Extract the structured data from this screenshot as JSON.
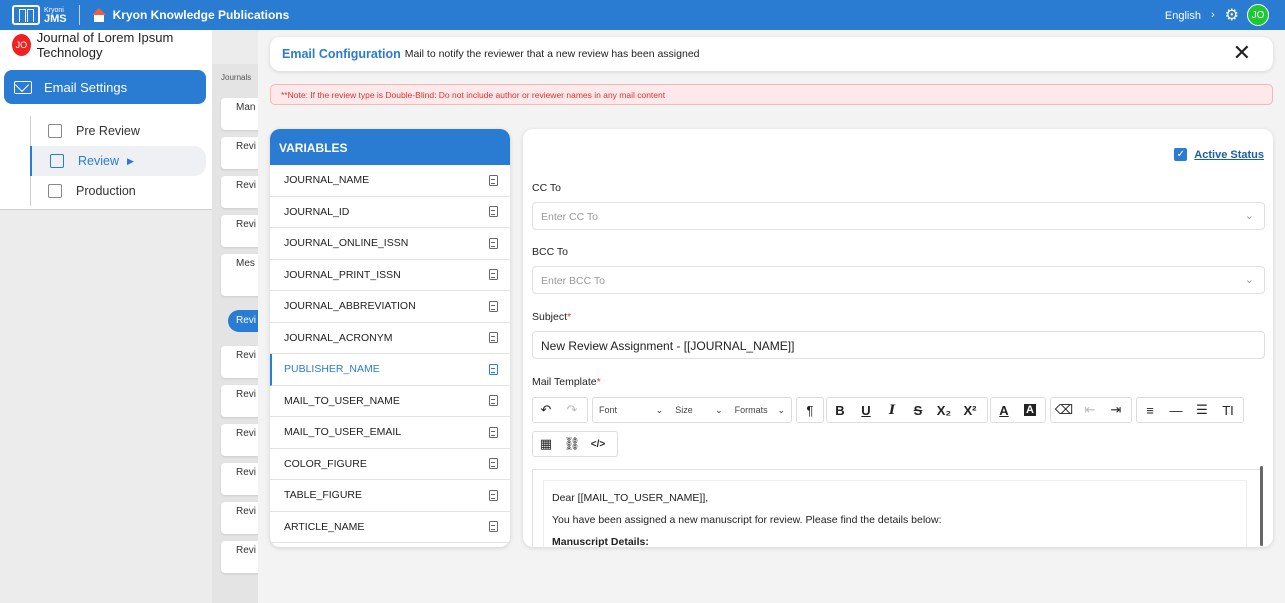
{
  "topbar": {
    "brand_small": "Kryoni",
    "brand_big": "JMS",
    "app_title": "Kryon Knowledge Publications",
    "language": "English",
    "avatar_initials": "JO"
  },
  "sidebar": {
    "journal_initials": "JO",
    "journal_name": "Journal of Lorem Ipsum Technology",
    "main_item": "Email Settings",
    "sub_items": [
      {
        "label": "Pre Review"
      },
      {
        "label": "Review"
      },
      {
        "label": "Production"
      }
    ]
  },
  "midcol": {
    "crumb": "Journals",
    "cards": [
      "Man",
      "Revi",
      "Revi",
      "Revi",
      "Mes disc",
      "Revi",
      "Revi",
      "Revi",
      "Revi",
      "Revi",
      "Revi"
    ],
    "pill": "Revi"
  },
  "header": {
    "title": "Email Configuration",
    "subtitle": "Mail to notify the reviewer that a new review has been assigned",
    "close": "✕"
  },
  "note": "**Note: If the review type is Double-Blind: Do not include author or reviewer names in any mail content",
  "variables": {
    "heading": "VARIABLES",
    "items": [
      "JOURNAL_NAME",
      "JOURNAL_ID",
      "JOURNAL_ONLINE_ISSN",
      "JOURNAL_PRINT_ISSN",
      "JOURNAL_ABBREVIATION",
      "JOURNAL_ACRONYM",
      "PUBLISHER_NAME",
      "MAIL_TO_USER_NAME",
      "MAIL_TO_USER_EMAIL",
      "COLOR_FIGURE",
      "TABLE_FIGURE",
      "ARTICLE_NAME"
    ],
    "active_index": 6
  },
  "form": {
    "active_status_label": "Active Status",
    "cc_label": "CC To",
    "cc_placeholder": "Enter CC To",
    "bcc_label": "BCC To",
    "bcc_placeholder": "Enter BCC To",
    "subject_label": "Subject",
    "subject_value": "New Review Assignment - [[JOURNAL_NAME]]",
    "template_label": "Mail Template",
    "required_mark": "*"
  },
  "toolbar": {
    "font_label": "Font",
    "size_label": "Size",
    "formats_label": "Formats"
  },
  "editor": {
    "line1": "Dear [[MAIL_TO_USER_NAME]],",
    "line2": "You have been assigned a new manuscript for review. Please find the details below:",
    "line3": "Manuscript Details:"
  },
  "colors": {
    "accent": "#2a7bd2",
    "avatar_green": "#1ec832",
    "journal_red": "#e22222",
    "note_red": "#dd3333"
  }
}
